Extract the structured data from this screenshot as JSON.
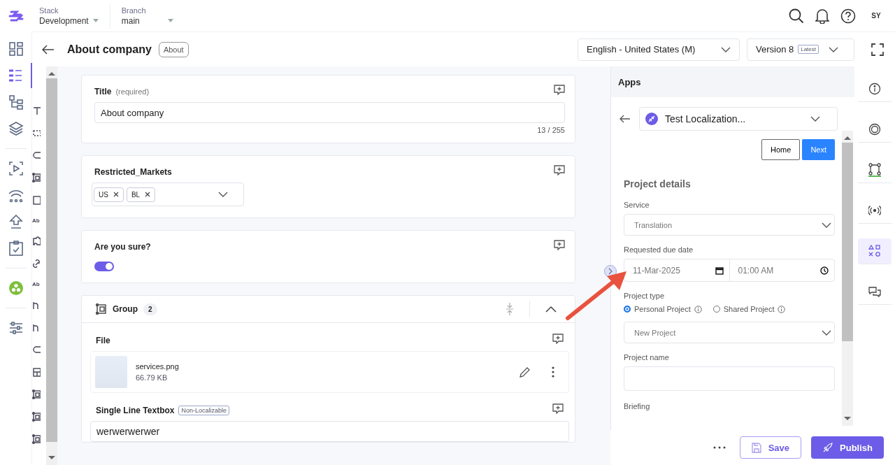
{
  "header": {
    "stack_label": "Stack",
    "stack": "Development",
    "branch_label": "Branch",
    "branch": "main",
    "avatar": "SY"
  },
  "rail": [
    {
      "kind": "dashboard",
      "selected": false
    },
    {
      "kind": "entries",
      "selected": true
    },
    {
      "kind": "hierarchy",
      "selected": false
    },
    {
      "kind": "layers",
      "selected": false
    },
    {
      "kind": "divider"
    },
    {
      "kind": "play",
      "selected": false
    },
    {
      "kind": "signal",
      "selected": false
    },
    {
      "kind": "upload",
      "selected": false
    },
    {
      "kind": "checklist",
      "selected": false
    },
    {
      "kind": "divider"
    },
    {
      "kind": "apps",
      "selected": false
    },
    {
      "kind": "divider"
    },
    {
      "kind": "sliders",
      "selected": false
    }
  ],
  "entry": {
    "title": "About company",
    "tag": "About",
    "locale": "English - United States (M)",
    "version": "Version 8",
    "version_badge": "Latest"
  },
  "field_types": [
    {
      "kind": "text"
    },
    {
      "kind": "dashed"
    },
    {
      "kind": "pill"
    },
    {
      "kind": "group"
    },
    {
      "kind": "rect"
    },
    {
      "kind": "label",
      "text": "Ab"
    },
    {
      "kind": "puzzle"
    },
    {
      "kind": "link"
    },
    {
      "kind": "label",
      "text": "Ab"
    },
    {
      "kind": "ref"
    },
    {
      "kind": "ref"
    },
    {
      "kind": "pill"
    },
    {
      "kind": "layout"
    },
    {
      "kind": "group"
    },
    {
      "kind": "group"
    },
    {
      "kind": "group"
    }
  ],
  "fields": [
    {
      "kind": "text",
      "label": "Title",
      "hint": "(required)",
      "value": "About company",
      "counter": "13 / 255"
    },
    {
      "kind": "tags",
      "label": "Restricted_Markets",
      "tags": [
        "US",
        "BL"
      ]
    },
    {
      "kind": "toggle",
      "label": "Are you sure?",
      "on": true
    },
    {
      "kind": "group",
      "label": "Group",
      "count": "2",
      "expanded": true,
      "children": [
        {
          "kind": "file",
          "label": "File",
          "filename": "services.png",
          "size": "66.79 KB"
        },
        {
          "kind": "line",
          "label": "Single Line Textbox",
          "badge": "Non-Localizable",
          "value": "werwerwerwer"
        }
      ]
    }
  ],
  "apps": {
    "title": "Apps",
    "app": "Test Localization...",
    "home": "Home",
    "next": "Next",
    "heading": "Project details",
    "service_label": "Service",
    "service": "Translation",
    "due_label": "Requested due date",
    "date": "11-Mar-2025",
    "time": "01:00 AM",
    "type_label": "Project type",
    "types": [
      {
        "label": "Personal Project",
        "selected": true
      },
      {
        "label": "Shared Project",
        "selected": false
      }
    ],
    "project": "New Project",
    "name_label": "Project name",
    "briefing_label": "Briefing"
  },
  "right_rail": [
    {
      "kind": "info",
      "selected": false
    },
    {
      "kind": "target",
      "selected": false
    },
    {
      "kind": "workflow",
      "selected": false
    },
    {
      "kind": "broadcast",
      "selected": false
    },
    {
      "kind": "shapes",
      "selected": true
    },
    {
      "kind": "chat",
      "selected": false
    }
  ],
  "footer": {
    "save": "Save",
    "publish": "Publish"
  }
}
